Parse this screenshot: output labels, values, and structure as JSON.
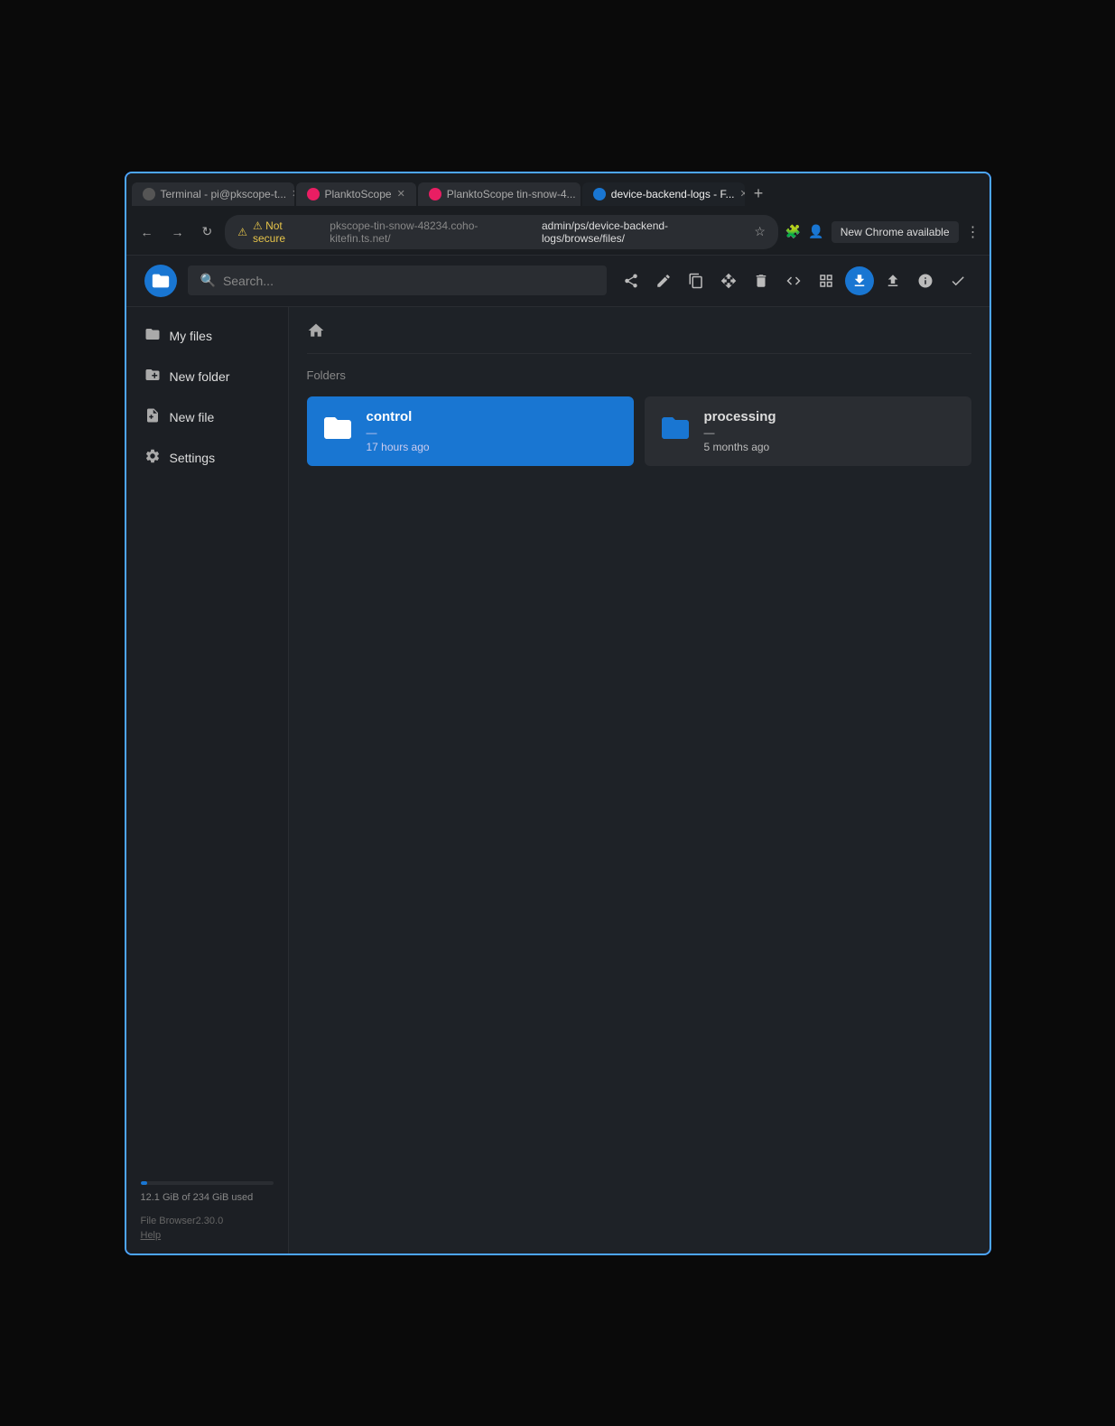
{
  "browser": {
    "tabs": [
      {
        "id": "tab-terminal",
        "label": "Terminal - pi@pkscope-t...",
        "favicon_color": "#555",
        "favicon_char": "T",
        "active": false
      },
      {
        "id": "tab-planktoscope",
        "label": "PlanktoScope",
        "favicon_color": "#e91e63",
        "favicon_char": "P",
        "active": false
      },
      {
        "id": "tab-planktoscope2",
        "label": "PlanktoScope tin-snow-4...",
        "favicon_color": "#e91e63",
        "favicon_char": "P",
        "active": false
      },
      {
        "id": "tab-device-backend",
        "label": "device-backend-logs - F...",
        "favicon_color": "#1976d2",
        "favicon_char": "F",
        "active": true
      }
    ],
    "new_tab_label": "+",
    "address": {
      "warning": "⚠ Not secure",
      "url_prefix": "pkscope-tin-snow-48234.coho-kitefin.ts.net/",
      "url_path": "admin/ps/device-backend-logs/browse/files/",
      "full_url": "pkscope-tin-snow-48234.coho-kitefin.ts.net/admin/ps/device-backend-logs/browse/files/"
    },
    "chrome_update": "New Chrome available",
    "nav": {
      "back": "←",
      "forward": "→",
      "reload": "↻"
    }
  },
  "app": {
    "logo_char": "📁",
    "search_placeholder": "Search...",
    "toolbar": {
      "share_label": "share",
      "edit_label": "edit",
      "copy_label": "copy",
      "move_label": "move",
      "delete_label": "delete",
      "code_label": "code",
      "grid_label": "grid",
      "download_label": "download",
      "upload_label": "upload",
      "info_label": "info",
      "check_label": "check"
    },
    "sidebar": {
      "items": [
        {
          "id": "my-files",
          "label": "My files",
          "icon": "📁"
        },
        {
          "id": "new-folder",
          "label": "New folder",
          "icon": "➕"
        },
        {
          "id": "new-file",
          "label": "New file",
          "icon": "📄"
        },
        {
          "id": "settings",
          "label": "Settings",
          "icon": "⚙"
        }
      ],
      "storage": {
        "used": "12.1 GiB",
        "total": "234 GiB",
        "label": "12.1 GiB of 234 GiB used",
        "percent": 5.2
      },
      "footer": {
        "version": "File Browser2.30.0",
        "help": "Help"
      }
    },
    "breadcrumb": {
      "home_icon": "🏠"
    },
    "folders_section_label": "Folders",
    "folders": [
      {
        "id": "folder-control",
        "name": "control",
        "dash": "—",
        "date": "17 hours ago",
        "selected": true
      },
      {
        "id": "folder-processing",
        "name": "processing",
        "dash": "—",
        "date": "5 months ago",
        "selected": false
      }
    ]
  }
}
